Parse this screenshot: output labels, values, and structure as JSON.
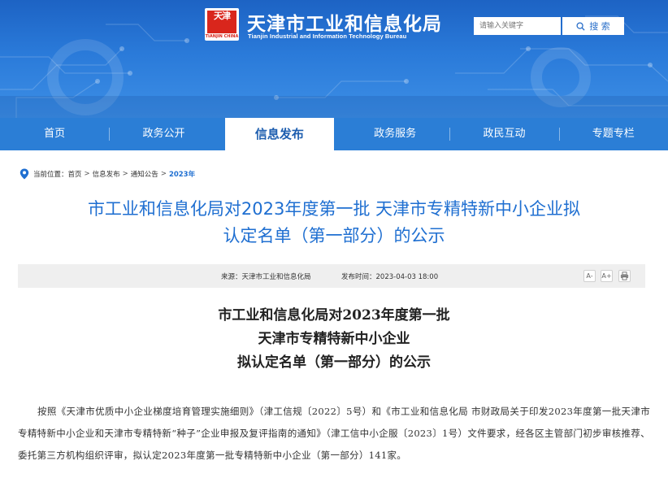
{
  "header": {
    "logo_text": "天津",
    "logo_caption": "TIANJIN CHINA",
    "title": "天津市工业和信息化局",
    "subtitle": "Tianjin Industrial and Information Technology Bureau",
    "search_placeholder": "请输入关键字",
    "search_button": "搜 索",
    "colors": {
      "banner": "#2a7ad9",
      "nav": "#2b7ed6",
      "accent": "#1f6fd1"
    }
  },
  "nav": {
    "items": [
      {
        "label": "首页"
      },
      {
        "label": "政务公开"
      },
      {
        "label": "信息发布",
        "active": true
      },
      {
        "label": "政务服务"
      },
      {
        "label": "政民互动"
      },
      {
        "label": "专题专栏"
      }
    ]
  },
  "breadcrumb": {
    "prefix": "当前位置：",
    "items": [
      "首页",
      "信息发布",
      "通知公告"
    ],
    "current": "2023年"
  },
  "article": {
    "headline_line1": "市工业和信息化局对2023年度第一批 天津市专精特新中小企业拟",
    "headline_line2": "认定名单（第一部分）的公示",
    "source": "来源：天津市工业和信息化局",
    "published": "发布时间：2023-04-03 18:00",
    "tools": {
      "font_decrease": "A-",
      "font_increase": "A+",
      "print_icon": "printer-icon"
    },
    "doc_title_line1": "市工业和信息化局对2023年度第一批",
    "doc_title_line2": "天津市专精特新中小企业",
    "doc_title_line3": "拟认定名单（第一部分）的公示",
    "body": "按照《天津市优质中小企业梯度培育管理实施细则》（津工信规〔2022〕5号）和《市工业和信息化局 市财政局关于印发2023年度第一批天津市专精特新中小企业和天津市专精特新“种子”企业申报及复评指南的通知》（津工信中小企服〔2023〕1号）文件要求，经各区主管部门初步审核推荐、委托第三方机构组织评审，拟认定2023年度第一批专精特新中小企业（第一部分）141家。"
  }
}
